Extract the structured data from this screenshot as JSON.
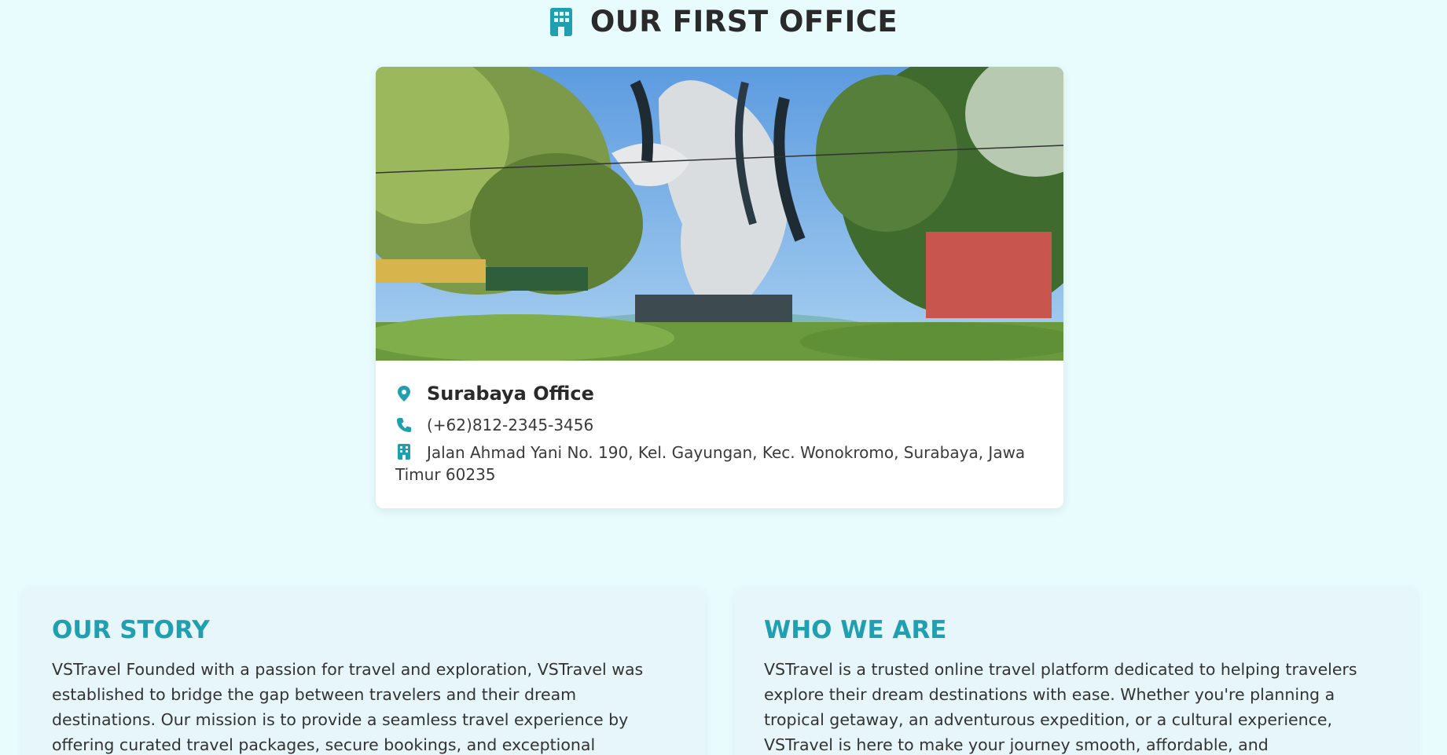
{
  "office_section": {
    "heading": "OUR FIRST OFFICE",
    "heading_icon": "building-icon",
    "office": {
      "name": "Surabaya Office",
      "phone": "(+62)812-2345-3456",
      "address": "Jalan Ahmad Yani No. 190, Kel. Gayungan, Kec. Wonokromo, Surabaya, Jawa Timur 60235",
      "photo": "suro-boyo-statue-photo",
      "icons": {
        "name": "location-pin-icon",
        "phone": "phone-icon",
        "address": "building-icon"
      }
    }
  },
  "story": {
    "title": "OUR STORY",
    "text": "VSTravel Founded with a passion for travel and exploration, VSTravel was established to bridge the gap between travelers and their dream destinations. Our mission is to provide a seamless travel experience by offering curated travel packages, secure bookings, and exceptional customer service. Over the years, we"
  },
  "who": {
    "title": "WHO WE ARE",
    "text": "VSTravel is a trusted online travel platform dedicated to helping travelers explore their dream destinations with ease. Whether you're planning a tropical getaway, an adventurous expedition, or a cultural experience, VSTravel is here to make your journey smooth, affordable, and unforgettable."
  },
  "colors": {
    "accent": "#1f9fb0",
    "background": "#e8fcfe",
    "card": "#ffffff",
    "soft_card": "#e6f6fb"
  }
}
